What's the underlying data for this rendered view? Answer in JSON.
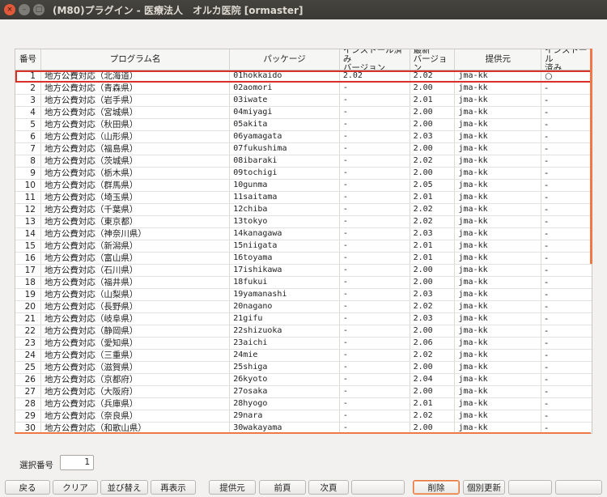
{
  "window": {
    "title": "(M80)プラグイン - 医療法人　オルカ医院 [ormaster]",
    "close_glyph": "×",
    "min_glyph": "–",
    "max_glyph": "□"
  },
  "table": {
    "headers": [
      "番号",
      "プログラム名",
      "パッケージ",
      "インストール済み\nバージョン",
      "最新\nバージョン",
      "提供元",
      "インストール\n済み"
    ],
    "selected_row": 1,
    "rows": [
      [
        "1",
        "地方公費対応（北海道）",
        "01hokkaido",
        "2.02",
        "2.02",
        "jma-kk",
        "○"
      ],
      [
        "2",
        "地方公費対応（青森県）",
        "02aomori",
        "-",
        "2.00",
        "jma-kk",
        "-"
      ],
      [
        "3",
        "地方公費対応（岩手県）",
        "03iwate",
        "-",
        "2.01",
        "jma-kk",
        "-"
      ],
      [
        "4",
        "地方公費対応（宮城県）",
        "04miyagi",
        "-",
        "2.00",
        "jma-kk",
        "-"
      ],
      [
        "5",
        "地方公費対応（秋田県）",
        "05akita",
        "-",
        "2.00",
        "jma-kk",
        "-"
      ],
      [
        "6",
        "地方公費対応（山形県）",
        "06yamagata",
        "-",
        "2.03",
        "jma-kk",
        "-"
      ],
      [
        "7",
        "地方公費対応（福島県）",
        "07fukushima",
        "-",
        "2.00",
        "jma-kk",
        "-"
      ],
      [
        "8",
        "地方公費対応（茨城県）",
        "08ibaraki",
        "-",
        "2.02",
        "jma-kk",
        "-"
      ],
      [
        "9",
        "地方公費対応（栃木県）",
        "09tochigi",
        "-",
        "2.00",
        "jma-kk",
        "-"
      ],
      [
        "10",
        "地方公費対応（群馬県）",
        "10gunma",
        "-",
        "2.05",
        "jma-kk",
        "-"
      ],
      [
        "11",
        "地方公費対応（埼玉県）",
        "11saitama",
        "-",
        "2.01",
        "jma-kk",
        "-"
      ],
      [
        "12",
        "地方公費対応（千葉県）",
        "12chiba",
        "-",
        "2.02",
        "jma-kk",
        "-"
      ],
      [
        "13",
        "地方公費対応（東京都）",
        "13tokyo",
        "-",
        "2.02",
        "jma-kk",
        "-"
      ],
      [
        "14",
        "地方公費対応（神奈川県）",
        "14kanagawa",
        "-",
        "2.03",
        "jma-kk",
        "-"
      ],
      [
        "15",
        "地方公費対応（新潟県）",
        "15niigata",
        "-",
        "2.01",
        "jma-kk",
        "-"
      ],
      [
        "16",
        "地方公費対応（富山県）",
        "16toyama",
        "-",
        "2.01",
        "jma-kk",
        "-"
      ],
      [
        "17",
        "地方公費対応（石川県）",
        "17ishikawa",
        "-",
        "2.00",
        "jma-kk",
        "-"
      ],
      [
        "18",
        "地方公費対応（福井県）",
        "18fukui",
        "-",
        "2.00",
        "jma-kk",
        "-"
      ],
      [
        "19",
        "地方公費対応（山梨県）",
        "19yamanashi",
        "-",
        "2.03",
        "jma-kk",
        "-"
      ],
      [
        "20",
        "地方公費対応（長野県）",
        "20nagano",
        "-",
        "2.02",
        "jma-kk",
        "-"
      ],
      [
        "21",
        "地方公費対応（岐阜県）",
        "21gifu",
        "-",
        "2.03",
        "jma-kk",
        "-"
      ],
      [
        "22",
        "地方公費対応（静岡県）",
        "22shizuoka",
        "-",
        "2.00",
        "jma-kk",
        "-"
      ],
      [
        "23",
        "地方公費対応（愛知県）",
        "23aichi",
        "-",
        "2.06",
        "jma-kk",
        "-"
      ],
      [
        "24",
        "地方公費対応（三重県）",
        "24mie",
        "-",
        "2.02",
        "jma-kk",
        "-"
      ],
      [
        "25",
        "地方公費対応（滋賀県）",
        "25shiga",
        "-",
        "2.00",
        "jma-kk",
        "-"
      ],
      [
        "26",
        "地方公費対応（京都府）",
        "26kyoto",
        "-",
        "2.04",
        "jma-kk",
        "-"
      ],
      [
        "27",
        "地方公費対応（大阪府）",
        "27osaka",
        "-",
        "2.00",
        "jma-kk",
        "-"
      ],
      [
        "28",
        "地方公費対応（兵庫県）",
        "28hyogo",
        "-",
        "2.01",
        "jma-kk",
        "-"
      ],
      [
        "29",
        "地方公費対応（奈良県）",
        "29nara",
        "-",
        "2.02",
        "jma-kk",
        "-"
      ],
      [
        "30",
        "地方公費対応（和歌山県）",
        "30wakayama",
        "-",
        "2.00",
        "jma-kk",
        "-"
      ]
    ]
  },
  "selection": {
    "label": "選択番号",
    "value": "1"
  },
  "buttons": [
    {
      "name": "back-button",
      "label": "戻る"
    },
    {
      "name": "clear-button",
      "label": "クリア"
    },
    {
      "name": "sort-button",
      "label": "並び替え"
    },
    {
      "name": "redisplay-button",
      "label": "再表示"
    },
    {
      "name": "provider-button",
      "label": "提供元"
    },
    {
      "name": "prev-page-button",
      "label": "前頁"
    },
    {
      "name": "next-page-button",
      "label": "次頁"
    },
    {
      "name": "empty-button-8",
      "label": ""
    },
    {
      "name": "delete-button",
      "label": "削除"
    },
    {
      "name": "individual-update-button",
      "label": "個別更新"
    },
    {
      "name": "empty-button-11",
      "label": ""
    },
    {
      "name": "empty-button-12",
      "label": ""
    }
  ],
  "colors": {
    "selection_outline": "#d9312a",
    "scrollbar": "#f07746"
  }
}
